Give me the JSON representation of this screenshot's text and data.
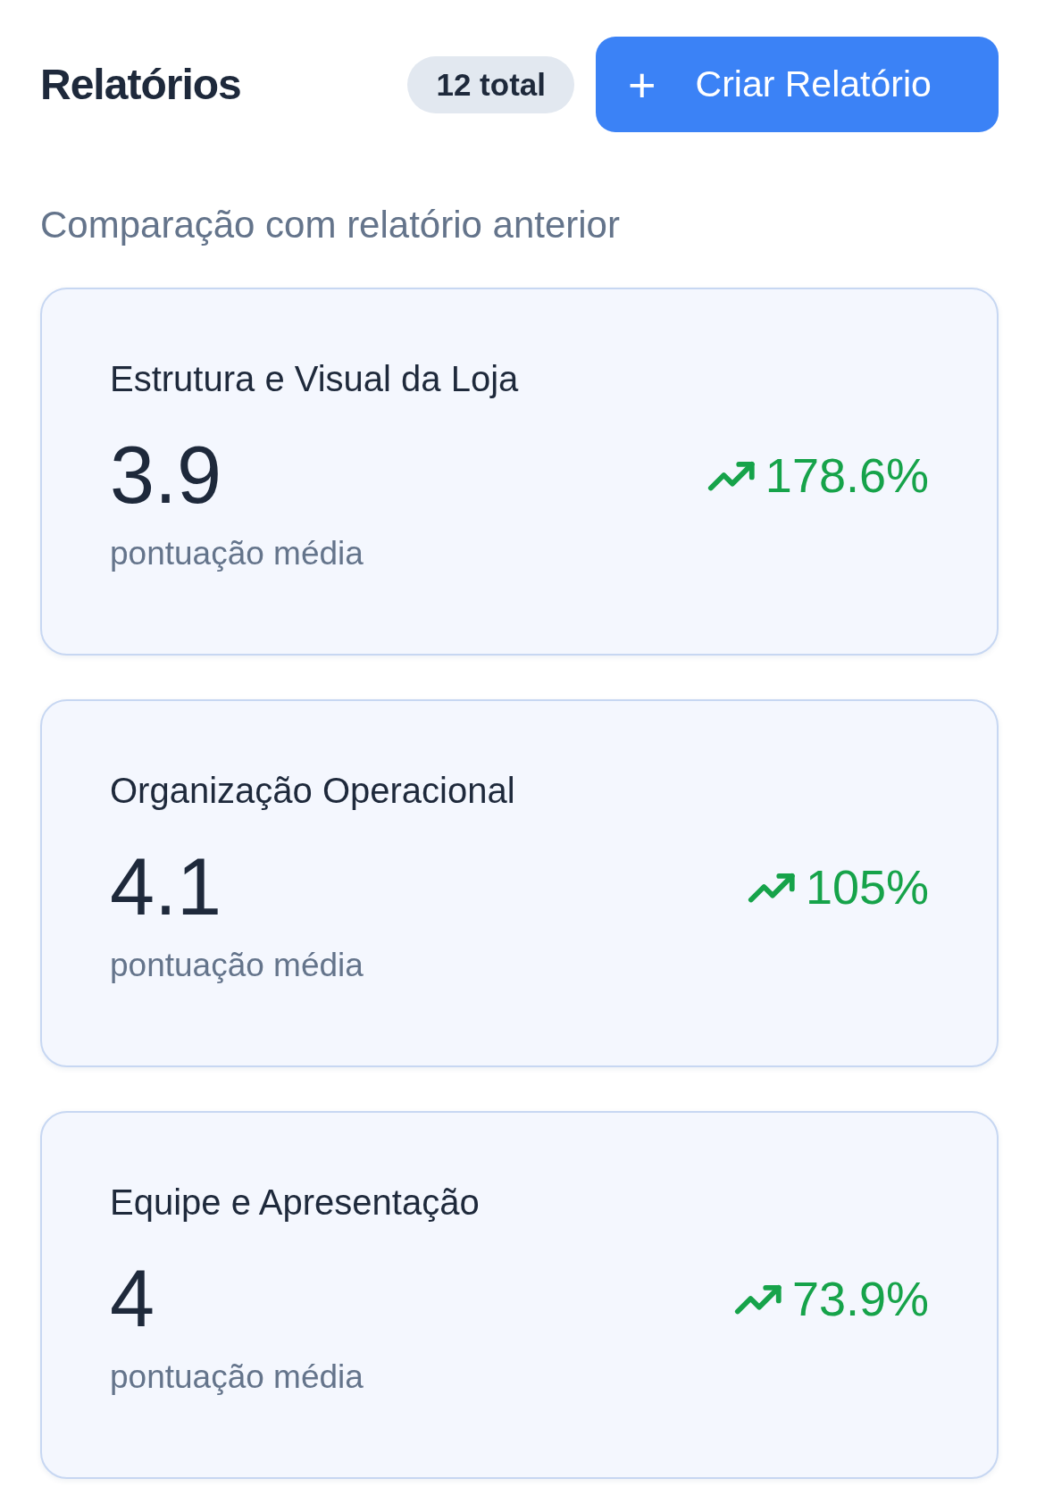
{
  "header": {
    "title": "Relatórios",
    "count_badge": "12 total",
    "create_button": {
      "icon": "+",
      "label": "Criar Relatório"
    }
  },
  "comparison": {
    "subtitle": "Comparação com relatório anterior",
    "cards": [
      {
        "title": "Estrutura e Visual da Loja",
        "score": "3.9",
        "score_label": "pontuação média",
        "increase": true,
        "change": "178.6%"
      },
      {
        "title": "Organização Operacional",
        "score": "4.1",
        "score_label": "pontuação média",
        "increase": true,
        "change": "105%"
      },
      {
        "title": "Equipe e Apresentação",
        "score": "4",
        "score_label": "pontuação média",
        "increase": true,
        "change": "73.9%"
      }
    ]
  }
}
